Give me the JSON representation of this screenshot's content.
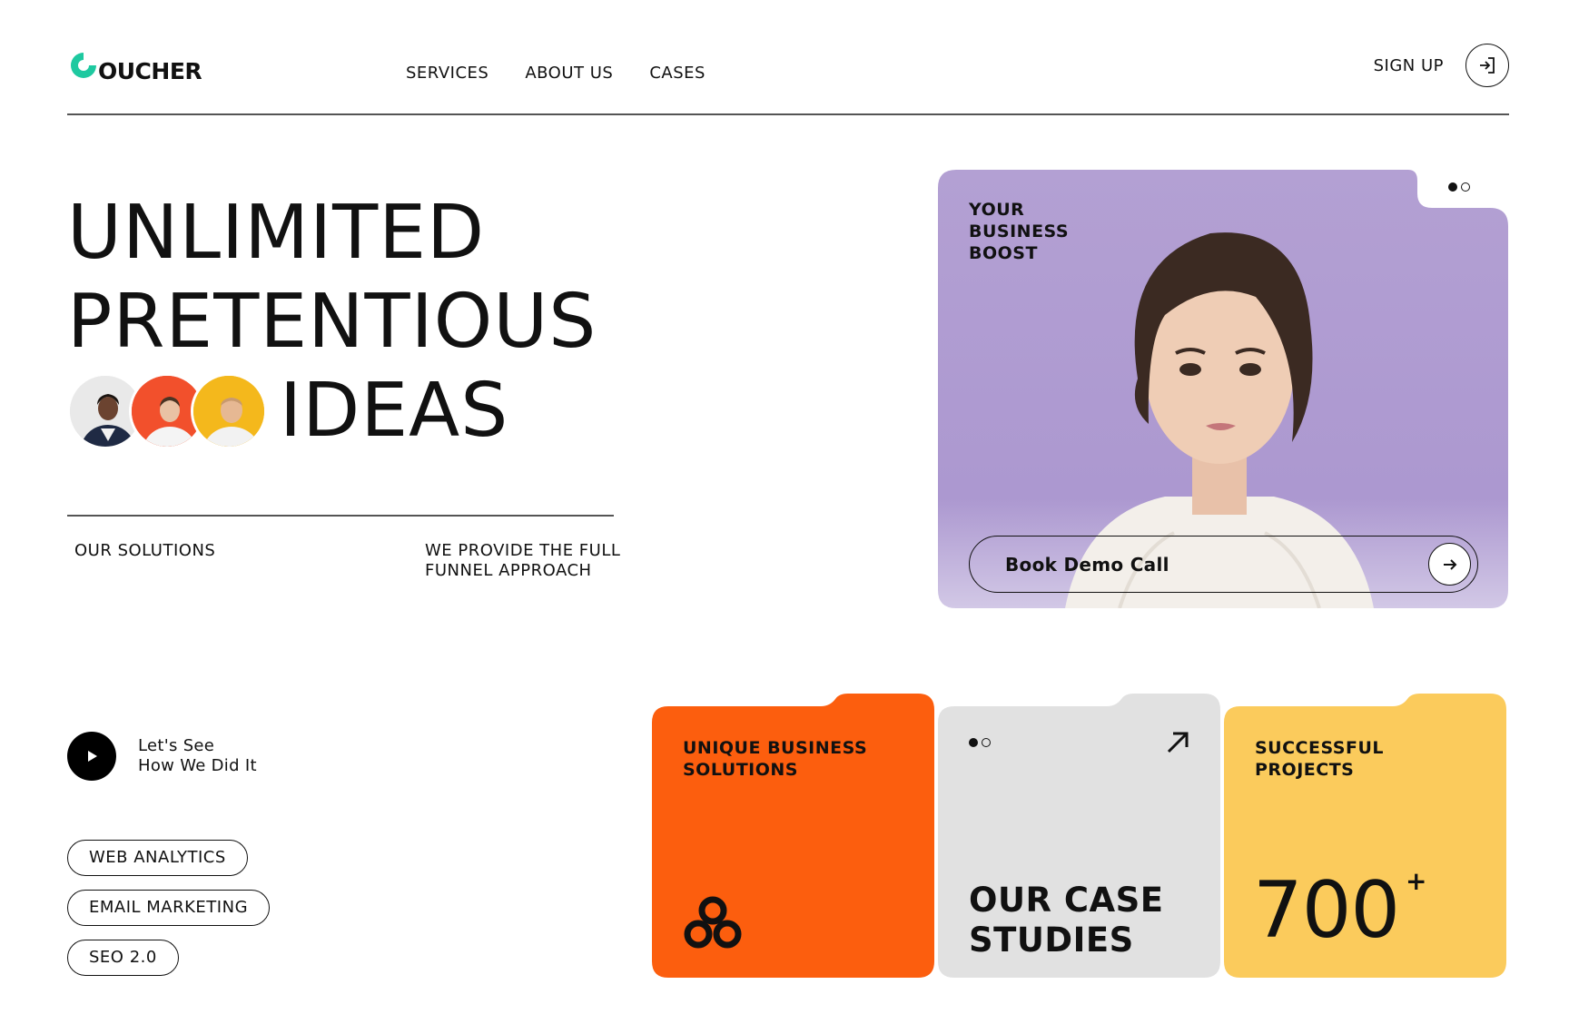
{
  "brand": {
    "logo_text": "OUCHER",
    "accent": "#1ec9a0"
  },
  "nav": {
    "items": [
      {
        "label": "SERVICES"
      },
      {
        "label": "ABOUT US"
      },
      {
        "label": "CASES"
      }
    ]
  },
  "auth": {
    "signup_label": "SIGN UP"
  },
  "hero": {
    "title_lines": [
      "UNLIMITED",
      "PRETENTIOUS",
      "IDEAS"
    ],
    "left_label": "OUR SOLUTIONS",
    "right_label": "WE PROVIDE THE FULL FUNNEL APPROACH"
  },
  "hero_card": {
    "label": "YOUR BUSINESS BOOST",
    "button_label": "Book Demo Call",
    "bg_color": "#b3a0d3"
  },
  "play": {
    "text_line1": "Let's See",
    "text_line2": "How We Did It"
  },
  "tags": [
    "WEB ANALYTICS",
    "EMAIL MARKETING",
    "SEO 2.0"
  ],
  "cards": {
    "solutions": {
      "label": "UNIQUE BUSINESS SOLUTIONS",
      "color": "#fc5e0e"
    },
    "cases": {
      "title": "OUR CASE STUDIES",
      "color": "#e1e1e1"
    },
    "projects": {
      "label": "SUCCESSFUL PROJECTS",
      "number": "700",
      "suffix": "+",
      "color": "#fbcb5c"
    }
  }
}
